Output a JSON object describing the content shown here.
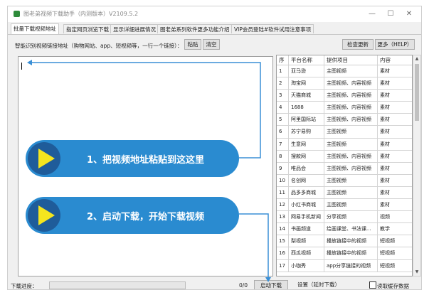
{
  "window": {
    "title": "图老弟视频下载助手（内测版本）V2109.5.2",
    "controls": {
      "minimize": "—",
      "maximize": "☐",
      "close": "✕"
    }
  },
  "tabs": [
    {
      "label": "批量下载视频地址",
      "active": true
    },
    {
      "label": "指定网页浏览下载",
      "active": false
    },
    {
      "label": "显示详细进展情况",
      "active": false
    },
    {
      "label": "图老弟系列软件更多功能介绍",
      "active": false
    },
    {
      "label": "VIP会员登陆#软件试用注意事项",
      "active": false
    }
  ],
  "toolbar": {
    "hint": "智能识别视频链接地址（购物网站、app、短视频等，一行一个链接）：",
    "paste_label": "粘贴",
    "clear_label": "清空",
    "check_update_label": "检查更新",
    "more_label": "更多（HELP）"
  },
  "table": {
    "headers": [
      "序",
      "平台名称",
      "提供项目",
      "内容"
    ],
    "rows": [
      [
        "1",
        "亚马逊",
        "主图视频",
        "素材"
      ],
      [
        "2",
        "淘宝网",
        "主图视频、内容视频",
        "素材"
      ],
      [
        "3",
        "天猫商城",
        "主图视频、内容视频",
        "素材"
      ],
      [
        "4",
        "1688",
        "主图视频、内容视频",
        "素材"
      ],
      [
        "5",
        "阿里国际站",
        "主图视频、内容视频",
        "素材"
      ],
      [
        "6",
        "苏宁易购",
        "主图视频",
        "素材"
      ],
      [
        "7",
        "生意网",
        "主图视频",
        "素材"
      ],
      [
        "8",
        "搜款网",
        "主图视频、内容视频",
        "素材"
      ],
      [
        "9",
        "唯品会",
        "主图视频、内容视频",
        "素材"
      ],
      [
        "10",
        "名创网",
        "主图视频",
        "素材"
      ],
      [
        "11",
        "品多多商城",
        "主图视频",
        "素材"
      ],
      [
        "12",
        "小红书商城",
        "主图视频",
        "素材"
      ],
      [
        "13",
        "网易手机新闻",
        "分享视频",
        "视频"
      ],
      [
        "14",
        "书画频道",
        "绘画课堂、书法课...",
        "教学"
      ],
      [
        "15",
        "梨视频",
        "播放链接中的视频",
        "短视频"
      ],
      [
        "16",
        "西瓜视频",
        "播放链接中的视频",
        "短视频"
      ],
      [
        "17",
        "小咖秀",
        "app分享链接的视频",
        "短视频"
      ]
    ]
  },
  "callouts": [
    {
      "text": "1、把视频地址粘贴到这这里"
    },
    {
      "text": "2、启动下载，开始下载视频"
    }
  ],
  "status": {
    "progress_label": "下载进度：",
    "progress_fraction": 0,
    "count": "0/0",
    "start_label": "启动下载",
    "settings_label": "设置（延时下载）",
    "read_cache_label": "读取缓存数据"
  },
  "colors": {
    "accent_blue": "#2a8bd0",
    "play_yellow": "#f5e51e",
    "arrow_blue": "#3a8fd6"
  }
}
